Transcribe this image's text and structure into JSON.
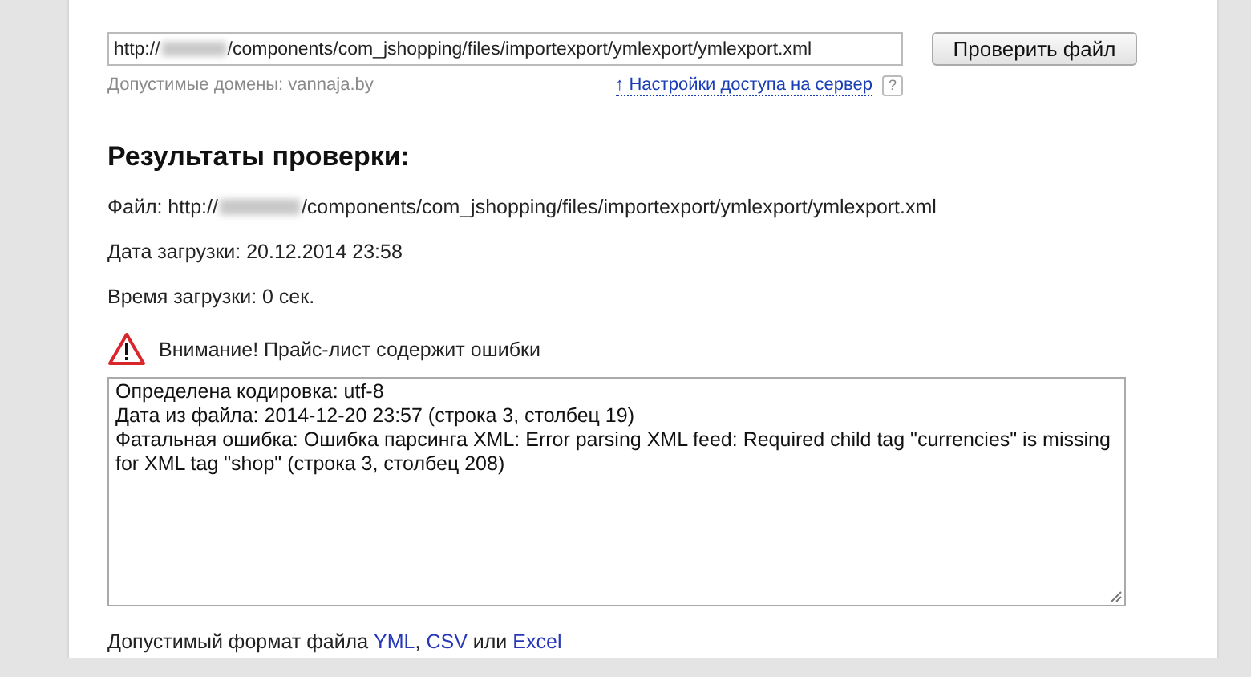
{
  "url_field": {
    "value_start": "http://",
    "value_end": "/components/com_jshopping/files/importexport/ymlexport/ymlexport.xml"
  },
  "check_button": "Проверить файл",
  "allowed_domains": "Допустимые домены: vannaja.by",
  "access_link": "↑ Настройки доступа на сервер",
  "help_badge": "?",
  "results": {
    "title": "Результаты проверки:",
    "file_start": "Файл: http://",
    "file_end": "/components/com_jshopping/files/importexport/ymlexport/ymlexport.xml",
    "load_date": "Дата загрузки: 20.12.2014 23:58",
    "load_time": "Время загрузки: 0 сек.",
    "warning": "Внимание! Прайс-лист содержит ошибки",
    "log": "Определена кодировка: utf-8\nДата из файла: 2014-12-20 23:57 (строка 3, столбец 19)\nФатальная ошибка: Ошибка парсинга XML: Error parsing XML feed: Required child tag \"currencies\" is missing for XML tag \"shop\" (строка 3, столбец 208)"
  },
  "formats": {
    "text": "Допустимый формат файла",
    "links": [
      {
        "label": "YML"
      },
      {
        "label": "CSV"
      },
      {
        "label": "Excel"
      }
    ],
    "separators": [
      ",",
      "или"
    ]
  }
}
